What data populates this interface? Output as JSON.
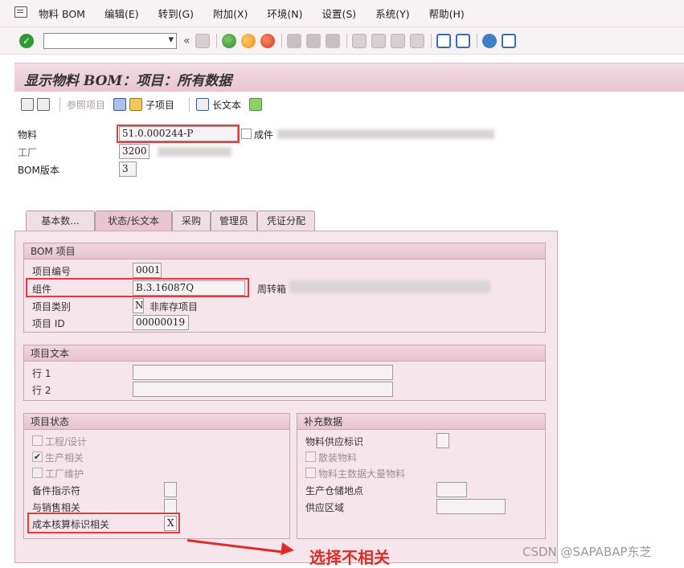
{
  "menu": {
    "items": [
      "物料 BOM",
      "编辑(E)",
      "转到(G)",
      "附加(X)",
      "环境(N)",
      "设置(S)",
      "系统(Y)",
      "帮助(H)"
    ]
  },
  "toolbar": {
    "command_value": "",
    "back_symbol": "«"
  },
  "title": "显示物料 BOM：项目：所有数据",
  "app_toolbar": {
    "ref_item": "参照项目",
    "sub_item": "子项目",
    "long_text": "长文本"
  },
  "header": {
    "material_label": "物料",
    "material_value": "51.0.000244-P",
    "material_desc": "成件",
    "plant_label": "工厂",
    "plant_value": "3200",
    "bom_version_label": "BOM版本",
    "bom_version_value": "3"
  },
  "tabs": [
    "基本数...",
    "状态/长文本",
    "采购",
    "管理员",
    "凭证分配"
  ],
  "bom_item": {
    "title": "BOM 项目",
    "item_no_label": "项目编号",
    "item_no_value": "0001",
    "component_label": "组件",
    "component_value": "B.3.16087Q",
    "component_desc": "周转箱",
    "item_cat_label": "项目类别",
    "item_cat_value": "N",
    "item_cat_desc": "非库存项目",
    "item_id_label": "项目 ID",
    "item_id_value": "00000019"
  },
  "item_text": {
    "title": "项目文本",
    "line1_label": "行 1",
    "line1_value": "",
    "line2_label": "行 2",
    "line2_value": ""
  },
  "item_status": {
    "title": "项目状态",
    "engineering": "工程/设计",
    "production": "生产相关",
    "plant_maint": "工厂维护",
    "spare_label": "备件指示符",
    "sales_label": "与销售相关",
    "costing_label": "成本核算标识相关",
    "costing_value": "X",
    "production_checked": "✔"
  },
  "supplement": {
    "title": "补充数据",
    "mat_supply_label": "物料供应标识",
    "bulk_material": "散装物料",
    "bulk_master": "物料主数据大量物料",
    "prod_storage_label": "生产仓储地点",
    "supply_area_label": "供应区域"
  },
  "annotation": "选择不相关",
  "watermark": "CSDN @SAPABAP东芝"
}
